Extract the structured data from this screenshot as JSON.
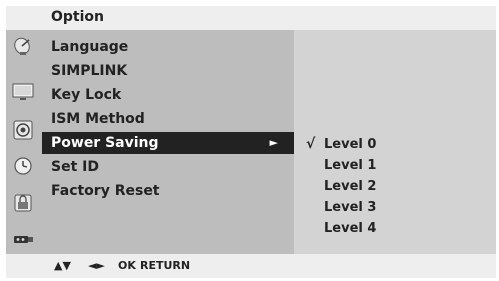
{
  "header": {
    "title": "Option"
  },
  "sidebar_icons": [
    {
      "name": "satellite-dish-icon"
    },
    {
      "name": "monitor-icon"
    },
    {
      "name": "speaker-icon"
    },
    {
      "name": "clock-icon"
    },
    {
      "name": "lock-icon"
    },
    {
      "name": "usb-plug-icon"
    }
  ],
  "menu": {
    "items": [
      {
        "label": "Language"
      },
      {
        "label": "SIMPLINK"
      },
      {
        "label": "Key Lock"
      },
      {
        "label": "ISM Method"
      },
      {
        "label": "Power Saving",
        "arrow": "►"
      },
      {
        "label": "Set ID"
      },
      {
        "label": "Factory Reset"
      }
    ],
    "selected_index": 4
  },
  "submenu": {
    "check_mark": "√",
    "items": [
      {
        "label": "Level 0"
      },
      {
        "label": "Level 1"
      },
      {
        "label": "Level 2"
      },
      {
        "label": "Level 3"
      },
      {
        "label": "Level 4"
      }
    ],
    "checked_index": 0
  },
  "footer": {
    "updown": "▲▼",
    "leftright": "◄►",
    "ok": "OK",
    "return": "RETURN"
  },
  "colors": {
    "panel": "#bdbdbd",
    "submenu_panel": "#d3d3d3",
    "frame": "#eeeeee",
    "highlight": "#222222",
    "highlight_text": "#ffffff"
  }
}
